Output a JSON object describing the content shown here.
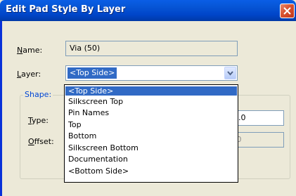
{
  "window": {
    "title": "Edit Pad Style By Layer"
  },
  "name_field": {
    "label": "Name:",
    "value": "Via (50)"
  },
  "layer_field": {
    "label": "Layer:",
    "selected": "<Top Side>",
    "options": [
      "<Top Side>",
      "Silkscreen Top",
      "Pin Names",
      "Top",
      "Bottom",
      "Silkscreen Bottom",
      "Documentation",
      "<Bottom Side>"
    ]
  },
  "shape_group": {
    "label": "Shape:",
    "type_label": "Type:",
    "type_value_partial": "50.0",
    "offset_label": "Offset:",
    "offset_value_partial": "0.0"
  },
  "colors": {
    "titlebar": "#0054e3",
    "selection": "#316ac5",
    "group_label": "#0046d5"
  },
  "icons": {
    "close": "close-icon",
    "dropdown": "chevron-down-icon"
  }
}
